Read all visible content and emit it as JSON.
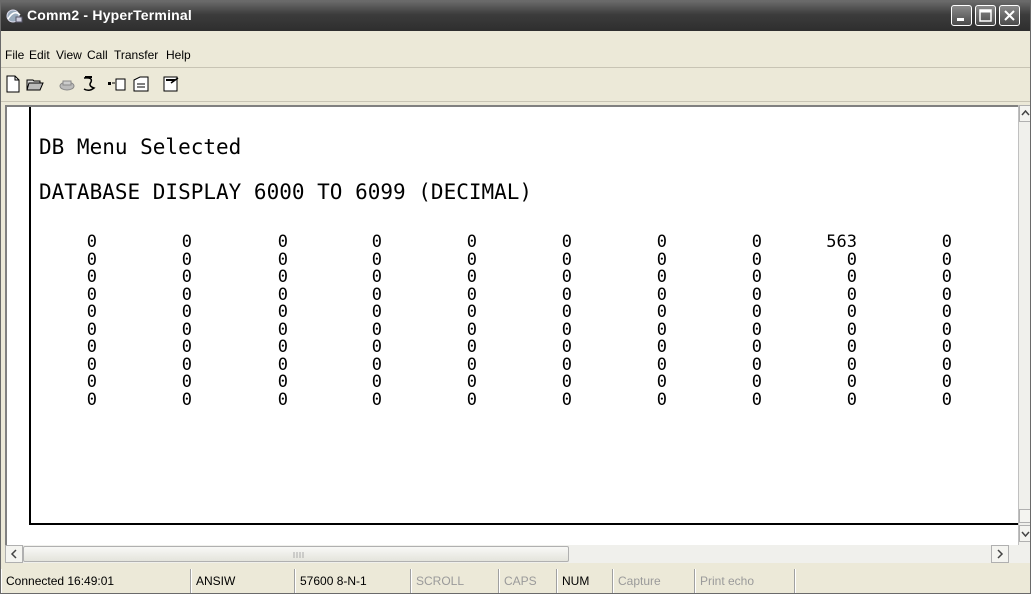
{
  "window": {
    "title": "Comm2 - HyperTerminal"
  },
  "menu": {
    "file": "File",
    "edit": "Edit",
    "view": "View",
    "call": "Call",
    "transfer": "Transfer",
    "help": "Help"
  },
  "toolbar": {
    "icons": [
      "new-icon",
      "open-icon",
      "disconnect-icon",
      "dial-icon",
      "send-icon",
      "receive-icon",
      "properties-icon"
    ]
  },
  "terminal": {
    "line1": "DB Menu Selected",
    "line2": "DATABASE DISPLAY 6000 TO 6099 (DECIMAL)",
    "rows": [
      [
        "0",
        "0",
        "0",
        "0",
        "0",
        "0",
        "0",
        "0",
        "563",
        "0"
      ],
      [
        "0",
        "0",
        "0",
        "0",
        "0",
        "0",
        "0",
        "0",
        "0",
        "0"
      ],
      [
        "0",
        "0",
        "0",
        "0",
        "0",
        "0",
        "0",
        "0",
        "0",
        "0"
      ],
      [
        "0",
        "0",
        "0",
        "0",
        "0",
        "0",
        "0",
        "0",
        "0",
        "0"
      ],
      [
        "0",
        "0",
        "0",
        "0",
        "0",
        "0",
        "0",
        "0",
        "0",
        "0"
      ],
      [
        "0",
        "0",
        "0",
        "0",
        "0",
        "0",
        "0",
        "0",
        "0",
        "0"
      ],
      [
        "0",
        "0",
        "0",
        "0",
        "0",
        "0",
        "0",
        "0",
        "0",
        "0"
      ],
      [
        "0",
        "0",
        "0",
        "0",
        "0",
        "0",
        "0",
        "0",
        "0",
        "0"
      ],
      [
        "0",
        "0",
        "0",
        "0",
        "0",
        "0",
        "0",
        "0",
        "0",
        "0"
      ],
      [
        "0",
        "0",
        "0",
        "0",
        "0",
        "0",
        "0",
        "0",
        "0",
        "0"
      ]
    ]
  },
  "status": {
    "connected": "Connected 16:49:01",
    "emulation": "ANSIW",
    "port": "57600 8-N-1",
    "scroll": "SCROLL",
    "caps": "CAPS",
    "num": "NUM",
    "capture": "Capture",
    "print_echo": "Print echo"
  }
}
